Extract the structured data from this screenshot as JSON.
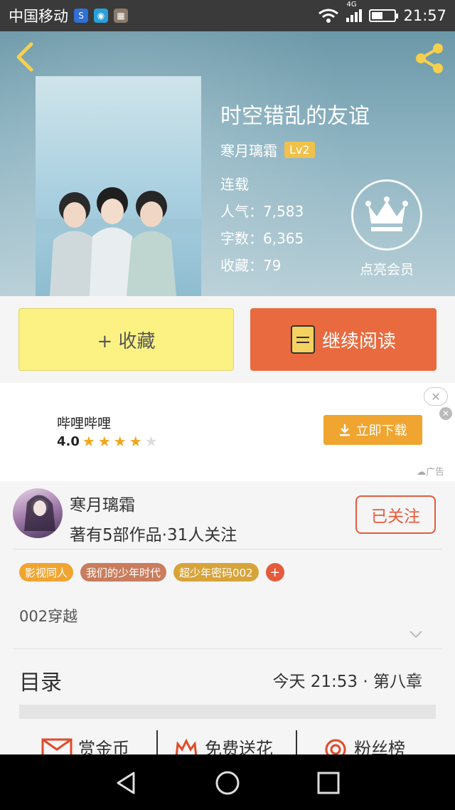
{
  "status_bar": {
    "carrier": "中国移动",
    "network": "4G",
    "time": "21:57",
    "battery_level": 0.5
  },
  "header": {
    "title": "时空错乱的友谊",
    "author": "寒月璃霜",
    "level": "Lv2",
    "status": "连载",
    "popularity": "人气：7,583",
    "word_count": "字数：6,365",
    "favorites": "收藏：79",
    "vip_label": "点亮会员"
  },
  "actions": {
    "collect": "+ 收藏",
    "read": "继续阅读"
  },
  "ad": {
    "name": "哔哩哔哩",
    "rating": "4.0",
    "stars": 4,
    "button": "立即下载",
    "tag": "广告"
  },
  "author_section": {
    "name": "寒月璃霜",
    "works": "著有5部作品·31人关注",
    "follow": "已关注",
    "tags": [
      {
        "label": "影视同人",
        "color": "#f0a530"
      },
      {
        "label": "我们的少年时代",
        "color": "#c97d5d"
      },
      {
        "label": "超少年密码002",
        "color": "#d7a43a"
      }
    ],
    "description": "002穿越"
  },
  "toc": {
    "title": "目录",
    "latest": "今天 21:53 · 第八章"
  },
  "bottom_items": [
    {
      "label": "赏金币",
      "icon": "envelope-icon"
    },
    {
      "label": "免费送花",
      "icon": "flower-icon"
    },
    {
      "label": "粉丝榜",
      "icon": "medal-icon"
    }
  ]
}
